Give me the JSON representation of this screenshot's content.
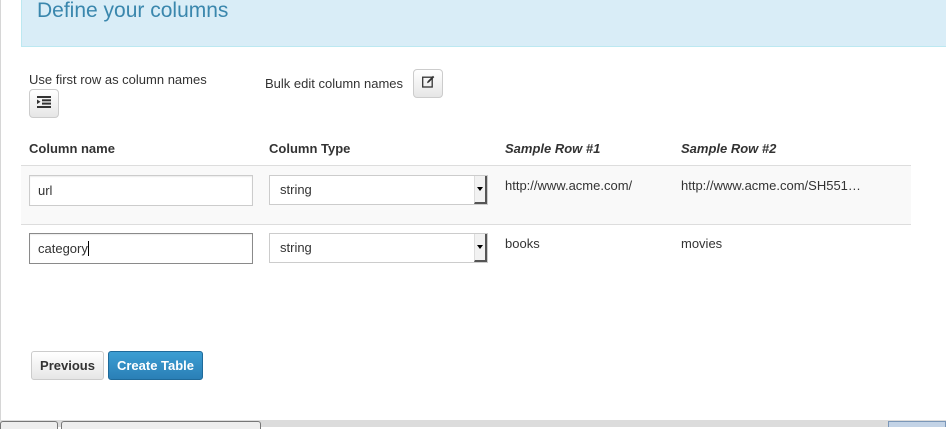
{
  "header": {
    "title": "Define your columns"
  },
  "options": {
    "first_row_label": "Use first row as column names",
    "bulk_edit_label": "Bulk edit column names"
  },
  "table": {
    "headers": {
      "column_name": "Column name",
      "column_type": "Column Type",
      "sample_row_1": "Sample Row #1",
      "sample_row_2": "Sample Row #2"
    },
    "rows": [
      {
        "name": "url",
        "type": "string",
        "sample1": "http://www.acme.com/",
        "sample2": "http://www.acme.com/SH551…"
      },
      {
        "name": "category",
        "type": "string",
        "sample1": "books",
        "sample2": "movies"
      }
    ]
  },
  "actions": {
    "previous_label": "Previous",
    "create_label": "Create Table"
  },
  "colors": {
    "header_bg": "#d9edf7",
    "header_text": "#3a87ad",
    "primary_button": "#2f8bc4"
  }
}
